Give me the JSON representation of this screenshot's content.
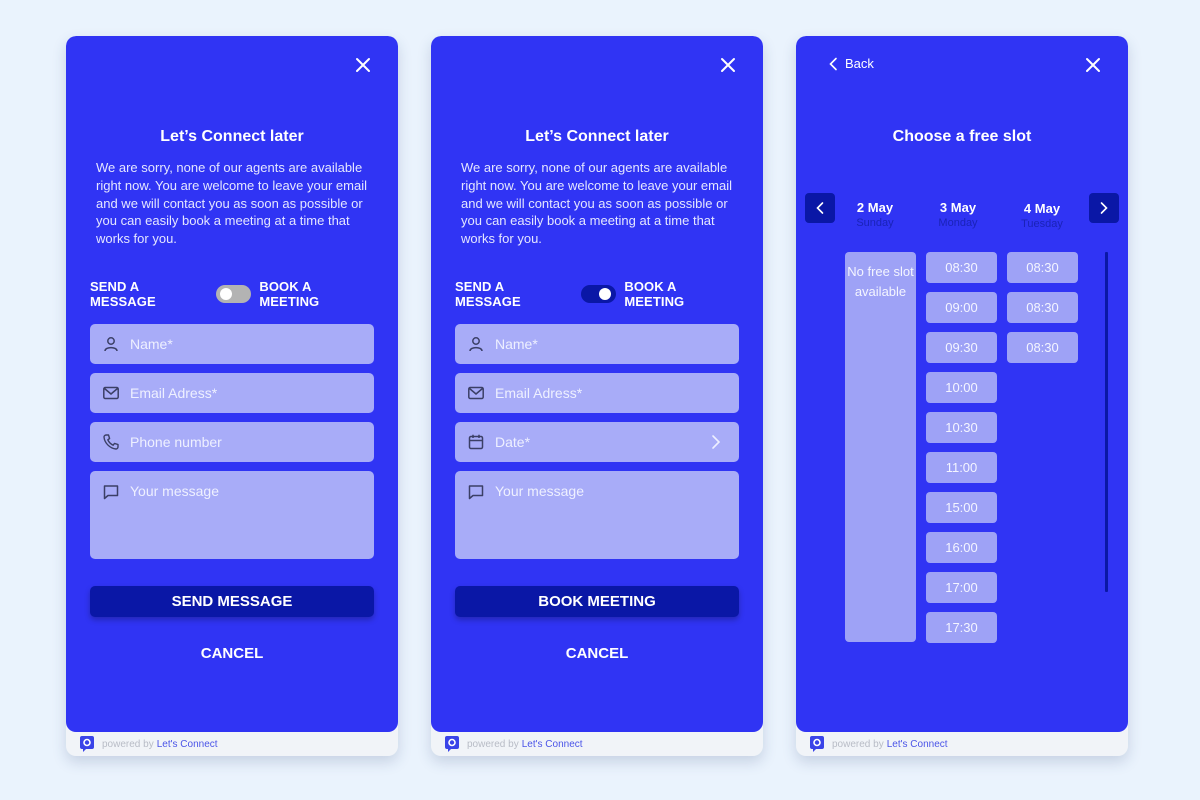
{
  "colors": {
    "background": "#eaf3fd",
    "panel": "#3034f4",
    "field": "#a8acf8",
    "primary_button": "#0a17a6",
    "slot": "#9ea2f6",
    "brand_link": "#4a54e8"
  },
  "footer": {
    "powered_by": "powered by",
    "brand": "Let's Connect"
  },
  "message_form": {
    "title": "Let’s Connect later",
    "description": "We are sorry, none of our agents are available right now. You are welcome to leave your email and we will contact you as soon as possible or you can easily book a meeting at a time that works for you.",
    "toggle": {
      "left_label": "SEND A MESSAGE",
      "right_label": "BOOK A MEETING",
      "state": "send-a-message"
    },
    "fields": [
      {
        "icon": "user-icon",
        "placeholder": "Name*",
        "value": ""
      },
      {
        "icon": "mail-icon",
        "placeholder": "Email Adress*",
        "value": ""
      },
      {
        "icon": "phone-icon",
        "placeholder": "Phone number",
        "value": ""
      },
      {
        "icon": "message-icon",
        "placeholder": "Your message",
        "value": ""
      }
    ],
    "submit_label": "SEND MESSAGE",
    "cancel_label": "CANCEL"
  },
  "meeting_form": {
    "title": "Let’s Connect later",
    "description": "We are sorry, none of our agents are available right now. You are welcome to leave your email and we will contact you as soon as possible or you can easily book a meeting at a time that works for you.",
    "toggle": {
      "left_label": "SEND A MESSAGE",
      "right_label": "BOOK A MEETING",
      "state": "book-a-meeting"
    },
    "fields": [
      {
        "icon": "user-icon",
        "placeholder": "Name*",
        "value": ""
      },
      {
        "icon": "mail-icon",
        "placeholder": "Email Adress*",
        "value": ""
      },
      {
        "icon": "calendar-icon",
        "placeholder": "Date*",
        "value": ""
      },
      {
        "icon": "message-icon",
        "placeholder": "Your message",
        "value": ""
      }
    ],
    "submit_label": "BOOK MEETING",
    "cancel_label": "CANCEL"
  },
  "slot_picker": {
    "back_label": "Back",
    "title": "Choose a free slot",
    "days": [
      {
        "date": "2 May",
        "weekday": "Sunday",
        "no_slot_text": "No free slot available",
        "slots": []
      },
      {
        "date": "3 May",
        "weekday": "Monday",
        "slots": [
          "08:30",
          "09:00",
          "09:30",
          "10:00",
          "10:30",
          "11:00",
          "15:00",
          "16:00",
          "17:00",
          "17:30"
        ]
      },
      {
        "date": "4 May",
        "weekday": "Tuesday",
        "slots": [
          "08:30",
          "08:30",
          "08:30"
        ]
      }
    ]
  }
}
